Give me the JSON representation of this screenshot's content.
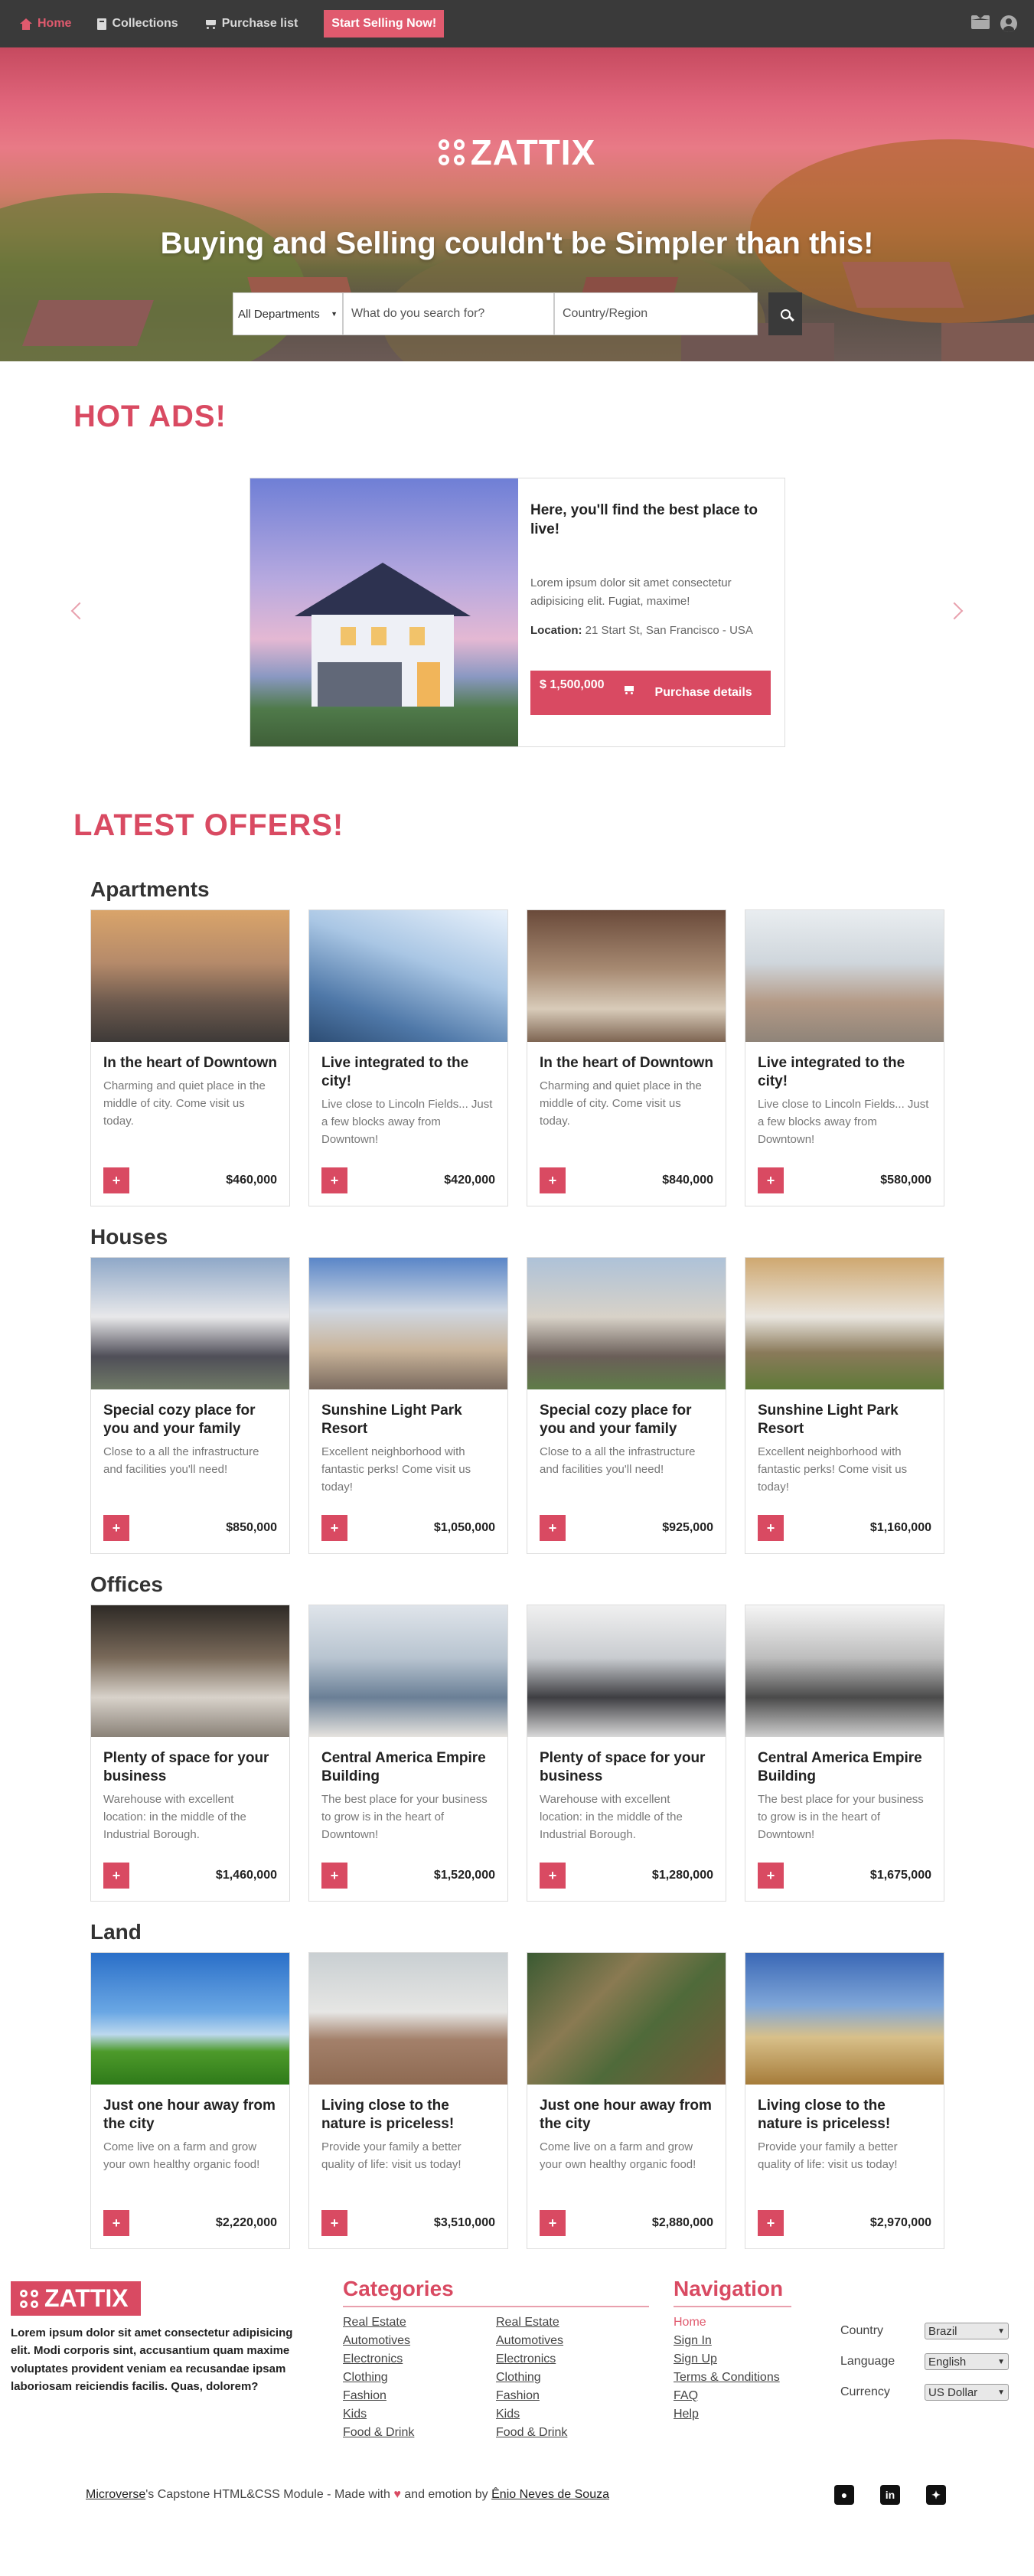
{
  "nav": {
    "home": "Home",
    "collections": "Collections",
    "purchase_list": "Purchase list",
    "sell_button": "Start Selling Now!"
  },
  "hero": {
    "logo": "ZATTIX",
    "title": "Buying and Selling couldn't be Simpler than this!",
    "department": "All Departments",
    "search_placeholder": "What do you search for?",
    "country_placeholder": "Country/Region"
  },
  "hot_ads": {
    "title": "HOT ADS!",
    "ad": {
      "title": "Here, you'll find the best place to live!",
      "description": "Lorem ipsum dolor sit amet consectetur adipisicing elit. Fugiat, maxime!",
      "location_label": "Location:",
      "location": "21 Start St, San Francisco - USA",
      "price": "$ 1,500,000",
      "details": "Purchase details"
    }
  },
  "latest": {
    "title": "LATEST OFFERS!",
    "categories": [
      {
        "name": "Apartments",
        "cards": [
          {
            "title": "In the heart of Downtown",
            "desc": "Charming and quiet place in the middle of city. Come visit us today.",
            "price": "$460,000"
          },
          {
            "title": "Live integrated to the city!",
            "desc": "Live close to Lincoln Fields... Just a few blocks away from Downtown!",
            "price": "$420,000"
          },
          {
            "title": "In the heart of Downtown",
            "desc": "Charming and quiet place in the middle of city. Come visit us today.",
            "price": "$840,000"
          },
          {
            "title": "Live integrated to the city!",
            "desc": "Live close to Lincoln Fields... Just a few blocks away from Downtown!",
            "price": "$580,000"
          }
        ]
      },
      {
        "name": "Houses",
        "cards": [
          {
            "title": "Special cozy place for you and your family",
            "desc": "Close to a all the infrastructure and facilities you'll need!",
            "price": "$850,000"
          },
          {
            "title": "Sunshine Light Park Resort",
            "desc": "Excellent neighborhood with fantastic perks! Come visit us today!",
            "price": "$1,050,000"
          },
          {
            "title": "Special cozy place for you and your family",
            "desc": "Close to a all the infrastructure and facilities you'll need!",
            "price": "$925,000"
          },
          {
            "title": "Sunshine Light Park Resort",
            "desc": "Excellent neighborhood with fantastic perks! Come visit us today!",
            "price": "$1,160,000"
          }
        ]
      },
      {
        "name": "Offices",
        "cards": [
          {
            "title": "Plenty of space for your business",
            "desc": "Warehouse with excellent location: in the middle of the Industrial Borough.",
            "price": "$1,460,000"
          },
          {
            "title": "Central America Empire Building",
            "desc": "The best place for your business to grow is in the heart of Downtown!",
            "price": "$1,520,000"
          },
          {
            "title": "Plenty of space for your business",
            "desc": "Warehouse with excellent location: in the middle of the Industrial Borough.",
            "price": "$1,280,000"
          },
          {
            "title": "Central America Empire Building",
            "desc": "The best place for your business to grow is in the heart of Downtown!",
            "price": "$1,675,000"
          }
        ]
      },
      {
        "name": "Land",
        "cards": [
          {
            "title": "Just one hour away from the city",
            "desc": "Come live on a farm and grow your own healthy organic food!",
            "price": "$2,220,000"
          },
          {
            "title": "Living close to the nature is priceless!",
            "desc": "Provide your family a better quality of life: visit us today!",
            "price": "$3,510,000"
          },
          {
            "title": "Just one hour away from the city",
            "desc": "Come live on a farm and grow your own healthy organic food!",
            "price": "$2,880,000"
          },
          {
            "title": "Living close to the nature is priceless!",
            "desc": "Provide your family a better quality of life: visit us today!",
            "price": "$2,970,000"
          }
        ]
      }
    ],
    "plus": "+"
  },
  "footer": {
    "logo": "ZATTIX",
    "about": "Lorem ipsum dolor sit amet consectetur adipisicing elit. Modi corporis sint, accusantium quam maxime voluptates provident veniam ea recusandae ipsam laboriosam reiciendis facilis. Quas, dolorem?",
    "categories_title": "Categories",
    "categories_col1": [
      "Real Estate",
      "Automotives",
      "Electronics",
      "Clothing",
      "Fashion",
      "Kids",
      "Food & Drink"
    ],
    "categories_col2": [
      "Real Estate",
      "Automotives",
      "Electronics",
      "Clothing",
      "Fashion",
      "Kids",
      "Food & Drink"
    ],
    "navigation_title": "Navigation",
    "navigation": [
      "Home",
      "Sign In",
      "Sign Up",
      "Terms & Conditions",
      "FAQ",
      "Help"
    ],
    "country_label": "Country",
    "country_value": "Brazil",
    "language_label": "Language",
    "language_value": "English",
    "currency_label": "Currency",
    "currency_value": "US Dollar",
    "credit_microverse": "Microverse",
    "credit_middle": "'s Capstone HTML&CSS Module - Made with",
    "credit_and": "and emotion by",
    "credit_author": "Ênio Neves de Souza"
  },
  "colors": {
    "accent": "#d94a62",
    "navbar": "#3a3a3a"
  },
  "icons": [
    "home-icon",
    "book-icon",
    "cart-icon",
    "envelope-icon",
    "user-icon",
    "search-icon",
    "github-icon",
    "linkedin-icon",
    "twitter-icon"
  ]
}
